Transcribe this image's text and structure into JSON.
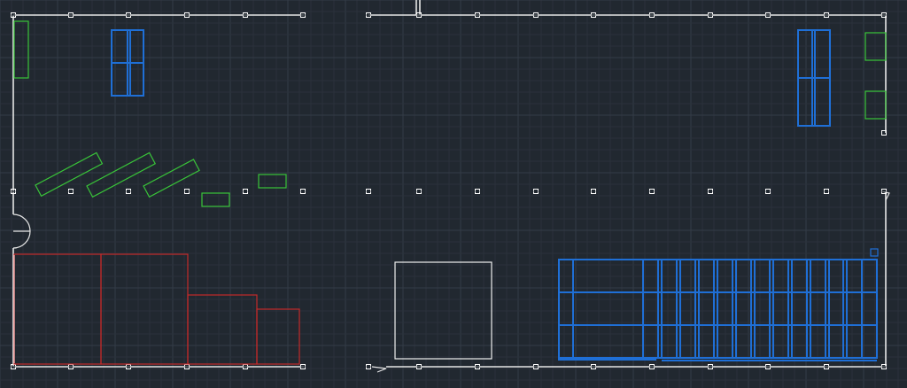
{
  "app": {
    "view": "cad-floor-plan-drawing-area"
  },
  "colors": {
    "background": "#212830",
    "grid_minor": "#2a313b",
    "grid_major": "#343c47",
    "wall": "#e6e6e6",
    "column": "#ffffff",
    "green_layer": "#39c439",
    "blue_layer": "#1f6fd6",
    "red_layer": "#c42a2a",
    "white_layer": "#f0f0f0",
    "pink_layer": "#f0a0a0"
  },
  "layers": [
    {
      "name": "walls",
      "color": "wall"
    },
    {
      "name": "columns",
      "color": "column"
    },
    {
      "name": "furniture-green",
      "color": "green_layer"
    },
    {
      "name": "racking-blue",
      "color": "blue_layer"
    },
    {
      "name": "zones-red",
      "color": "red_layer"
    },
    {
      "name": "equipment-white",
      "color": "white_layer"
    }
  ]
}
